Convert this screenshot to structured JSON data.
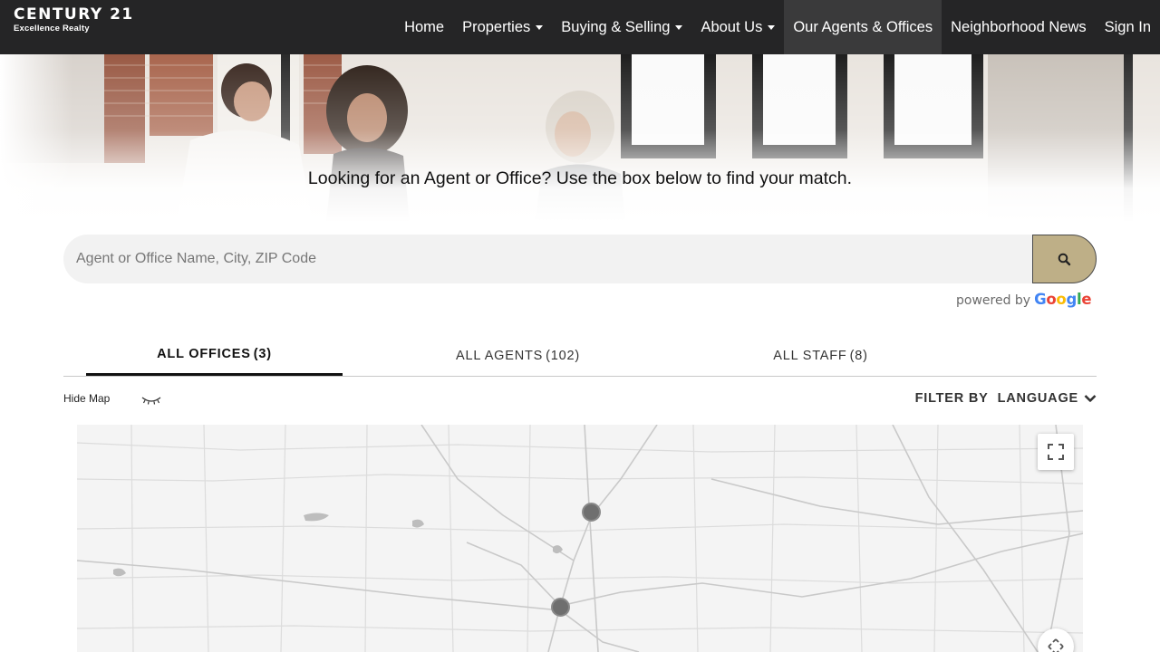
{
  "brand": {
    "name": "CENTURY 21",
    "tagline": "Excellence Realty"
  },
  "nav": [
    {
      "label": "Home",
      "dropdown": false,
      "active": false
    },
    {
      "label": "Properties",
      "dropdown": true,
      "active": false
    },
    {
      "label": "Buying & Selling",
      "dropdown": true,
      "active": false
    },
    {
      "label": "About Us",
      "dropdown": true,
      "active": false
    },
    {
      "label": "Our Agents & Offices",
      "dropdown": false,
      "active": true
    },
    {
      "label": "Neighborhood News",
      "dropdown": false,
      "active": false
    },
    {
      "label": "Sign In",
      "dropdown": false,
      "active": false
    }
  ],
  "hero": {
    "text": "Looking for an Agent or Office? Use the box below to find your match."
  },
  "search": {
    "placeholder": "Agent or Office Name, City, ZIP Code",
    "value": "",
    "button_icon": "search-icon",
    "powered_by": "powered by",
    "google": [
      "G",
      "o",
      "o",
      "g",
      "l",
      "e"
    ],
    "google_colors": [
      "#4285F4",
      "#EA4335",
      "#FBBC05",
      "#4285F4",
      "#34A853",
      "#EA4335"
    ]
  },
  "tabs": [
    {
      "label": "ALL OFFICES",
      "count": "(3)",
      "active": true
    },
    {
      "label": "ALL AGENTS",
      "count": "(102)",
      "active": false
    },
    {
      "label": "ALL STAFF",
      "count": "(8)",
      "active": false
    }
  ],
  "map_controls": {
    "hide_map": "Hide Map",
    "eye_icon": "eye-closed-icon"
  },
  "filter": {
    "label": "FILTER BY",
    "value": "LANGUAGE",
    "icon": "chevron-down-icon"
  },
  "map": {
    "markers": 2,
    "fullscreen_icon": "fullscreen-icon",
    "pan_icon": "pan-icon"
  },
  "colors": {
    "header_bg": "#252526",
    "nav_active_bg": "#3a3a3b",
    "search_button": "#beaf87",
    "marker": "#6f6f6f"
  }
}
